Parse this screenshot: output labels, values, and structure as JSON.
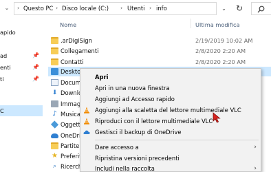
{
  "address": {
    "crumbs": [
      "Questo PC",
      "Disco locale (C:)",
      "Utenti",
      "info"
    ],
    "separator": "›"
  },
  "nav_pane": [
    {
      "label": "apido",
      "pinned": false
    },
    {
      "label": "ad",
      "pinned": true
    },
    {
      "label": "enti",
      "pinned": true
    },
    {
      "label": "ti",
      "pinned": true
    },
    {
      "label": "",
      "pinned": false
    },
    {
      "label": "C",
      "pinned": false
    }
  ],
  "file_list": {
    "headers": {
      "name": "Nome",
      "date": "Ultima modifica"
    },
    "rows": [
      {
        "name": ".arDigiSign",
        "date": "2/19/2019 10:02 AM",
        "icon": "folder-yellow-icon"
      },
      {
        "name": "Collegamenti",
        "date": "2/8/2020 2:20 AM",
        "icon": "folder-yellow-icon"
      },
      {
        "name": "Contatti",
        "date": "2/8/2020 2:20 AM",
        "icon": "folder-yellow-icon"
      },
      {
        "name": "Deskto",
        "date": "",
        "icon": "folder-blue-icon"
      },
      {
        "name": "Docum",
        "date": "",
        "icon": "document-icon"
      },
      {
        "name": "Downlo",
        "date": "",
        "icon": "download-icon"
      },
      {
        "name": "Immag",
        "date": "",
        "icon": "pictures-icon"
      },
      {
        "name": "Musica",
        "date": "",
        "icon": "music-icon"
      },
      {
        "name": "Oggetti",
        "date": "",
        "icon": "3d-objects-icon"
      },
      {
        "name": "OneDri",
        "date": "",
        "icon": "onedrive-icon"
      },
      {
        "name": "Partite",
        "date": "",
        "icon": "games-folder-icon"
      },
      {
        "name": "Preferit",
        "date": "",
        "icon": "favorites-icon"
      },
      {
        "name": "Ricerch",
        "date": "",
        "icon": "searches-icon"
      }
    ]
  },
  "context_menu": {
    "items": [
      {
        "label": "Apri",
        "bold": true
      },
      {
        "label": "Apri in una nuova finestra"
      },
      {
        "label": "Aggiungi ad Accesso rapido"
      },
      {
        "label": "Aggiungi alla scaletta del lettore multimediale VLC",
        "icon": "vlc-cone-icon"
      },
      {
        "label": "Riproduci con il lettore multimediale VLC",
        "icon": "vlc-cone-icon"
      },
      {
        "label": "Gestisci il backup di OneDrive",
        "icon": "onedrive-cloud-icon"
      },
      {
        "label": "Dare accesso a",
        "submenu": true
      },
      {
        "label": "Ripristina versioni precedenti"
      },
      {
        "label": "Includi nella raccolta",
        "submenu": true
      }
    ]
  },
  "colors": {
    "selection": "#cce8ff",
    "menu_bg": "#f2f2f2",
    "header_text": "#4c607a",
    "date_text": "#6d6d6d",
    "vlc_orange": "#f08a00",
    "onedrive_blue": "#2f7fd1"
  }
}
